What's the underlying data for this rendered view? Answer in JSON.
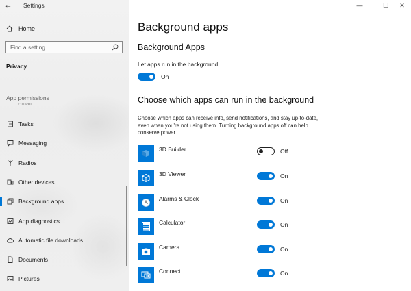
{
  "window": {
    "title": "Settings",
    "minimize": "—",
    "maximize": "☐",
    "close": "✕"
  },
  "sidebar": {
    "back": "←",
    "home": "Home",
    "search_placeholder": "Find a setting",
    "section": "Privacy",
    "group": "App permissions",
    "cut_item": "Email",
    "items": [
      {
        "label": "Tasks",
        "icon": "tasks-icon"
      },
      {
        "label": "Messaging",
        "icon": "messaging-icon"
      },
      {
        "label": "Radios",
        "icon": "radios-icon"
      },
      {
        "label": "Other devices",
        "icon": "other-devices-icon"
      },
      {
        "label": "Background apps",
        "icon": "background-apps-icon",
        "active": true
      },
      {
        "label": "App diagnostics",
        "icon": "app-diagnostics-icon"
      },
      {
        "label": "Automatic file downloads",
        "icon": "cloud-icon"
      },
      {
        "label": "Documents",
        "icon": "document-icon"
      },
      {
        "label": "Pictures",
        "icon": "pictures-icon"
      }
    ]
  },
  "main": {
    "title": "Background apps",
    "subtitle": "Background Apps",
    "master_label": "Let apps run in the background",
    "master_state": "On",
    "choose_title": "Choose which apps can run in the background",
    "description": "Choose which apps can receive info, send notifications, and stay up-to-date, even when you're not using them. Turning background apps off can help conserve power.",
    "apps": [
      {
        "name": "3D Builder",
        "state": "Off",
        "on": false,
        "icon": "3d-builder-icon"
      },
      {
        "name": "3D Viewer",
        "state": "On",
        "on": true,
        "icon": "3d-viewer-icon"
      },
      {
        "name": "Alarms & Clock",
        "state": "On",
        "on": true,
        "icon": "alarms-clock-icon"
      },
      {
        "name": "Calculator",
        "state": "On",
        "on": true,
        "icon": "calculator-icon"
      },
      {
        "name": "Camera",
        "state": "On",
        "on": true,
        "icon": "camera-icon"
      },
      {
        "name": "Connect",
        "state": "On",
        "on": true,
        "icon": "connect-icon"
      }
    ]
  },
  "colors": {
    "accent": "#0078d7",
    "sidebar_bg": "#efefef"
  }
}
